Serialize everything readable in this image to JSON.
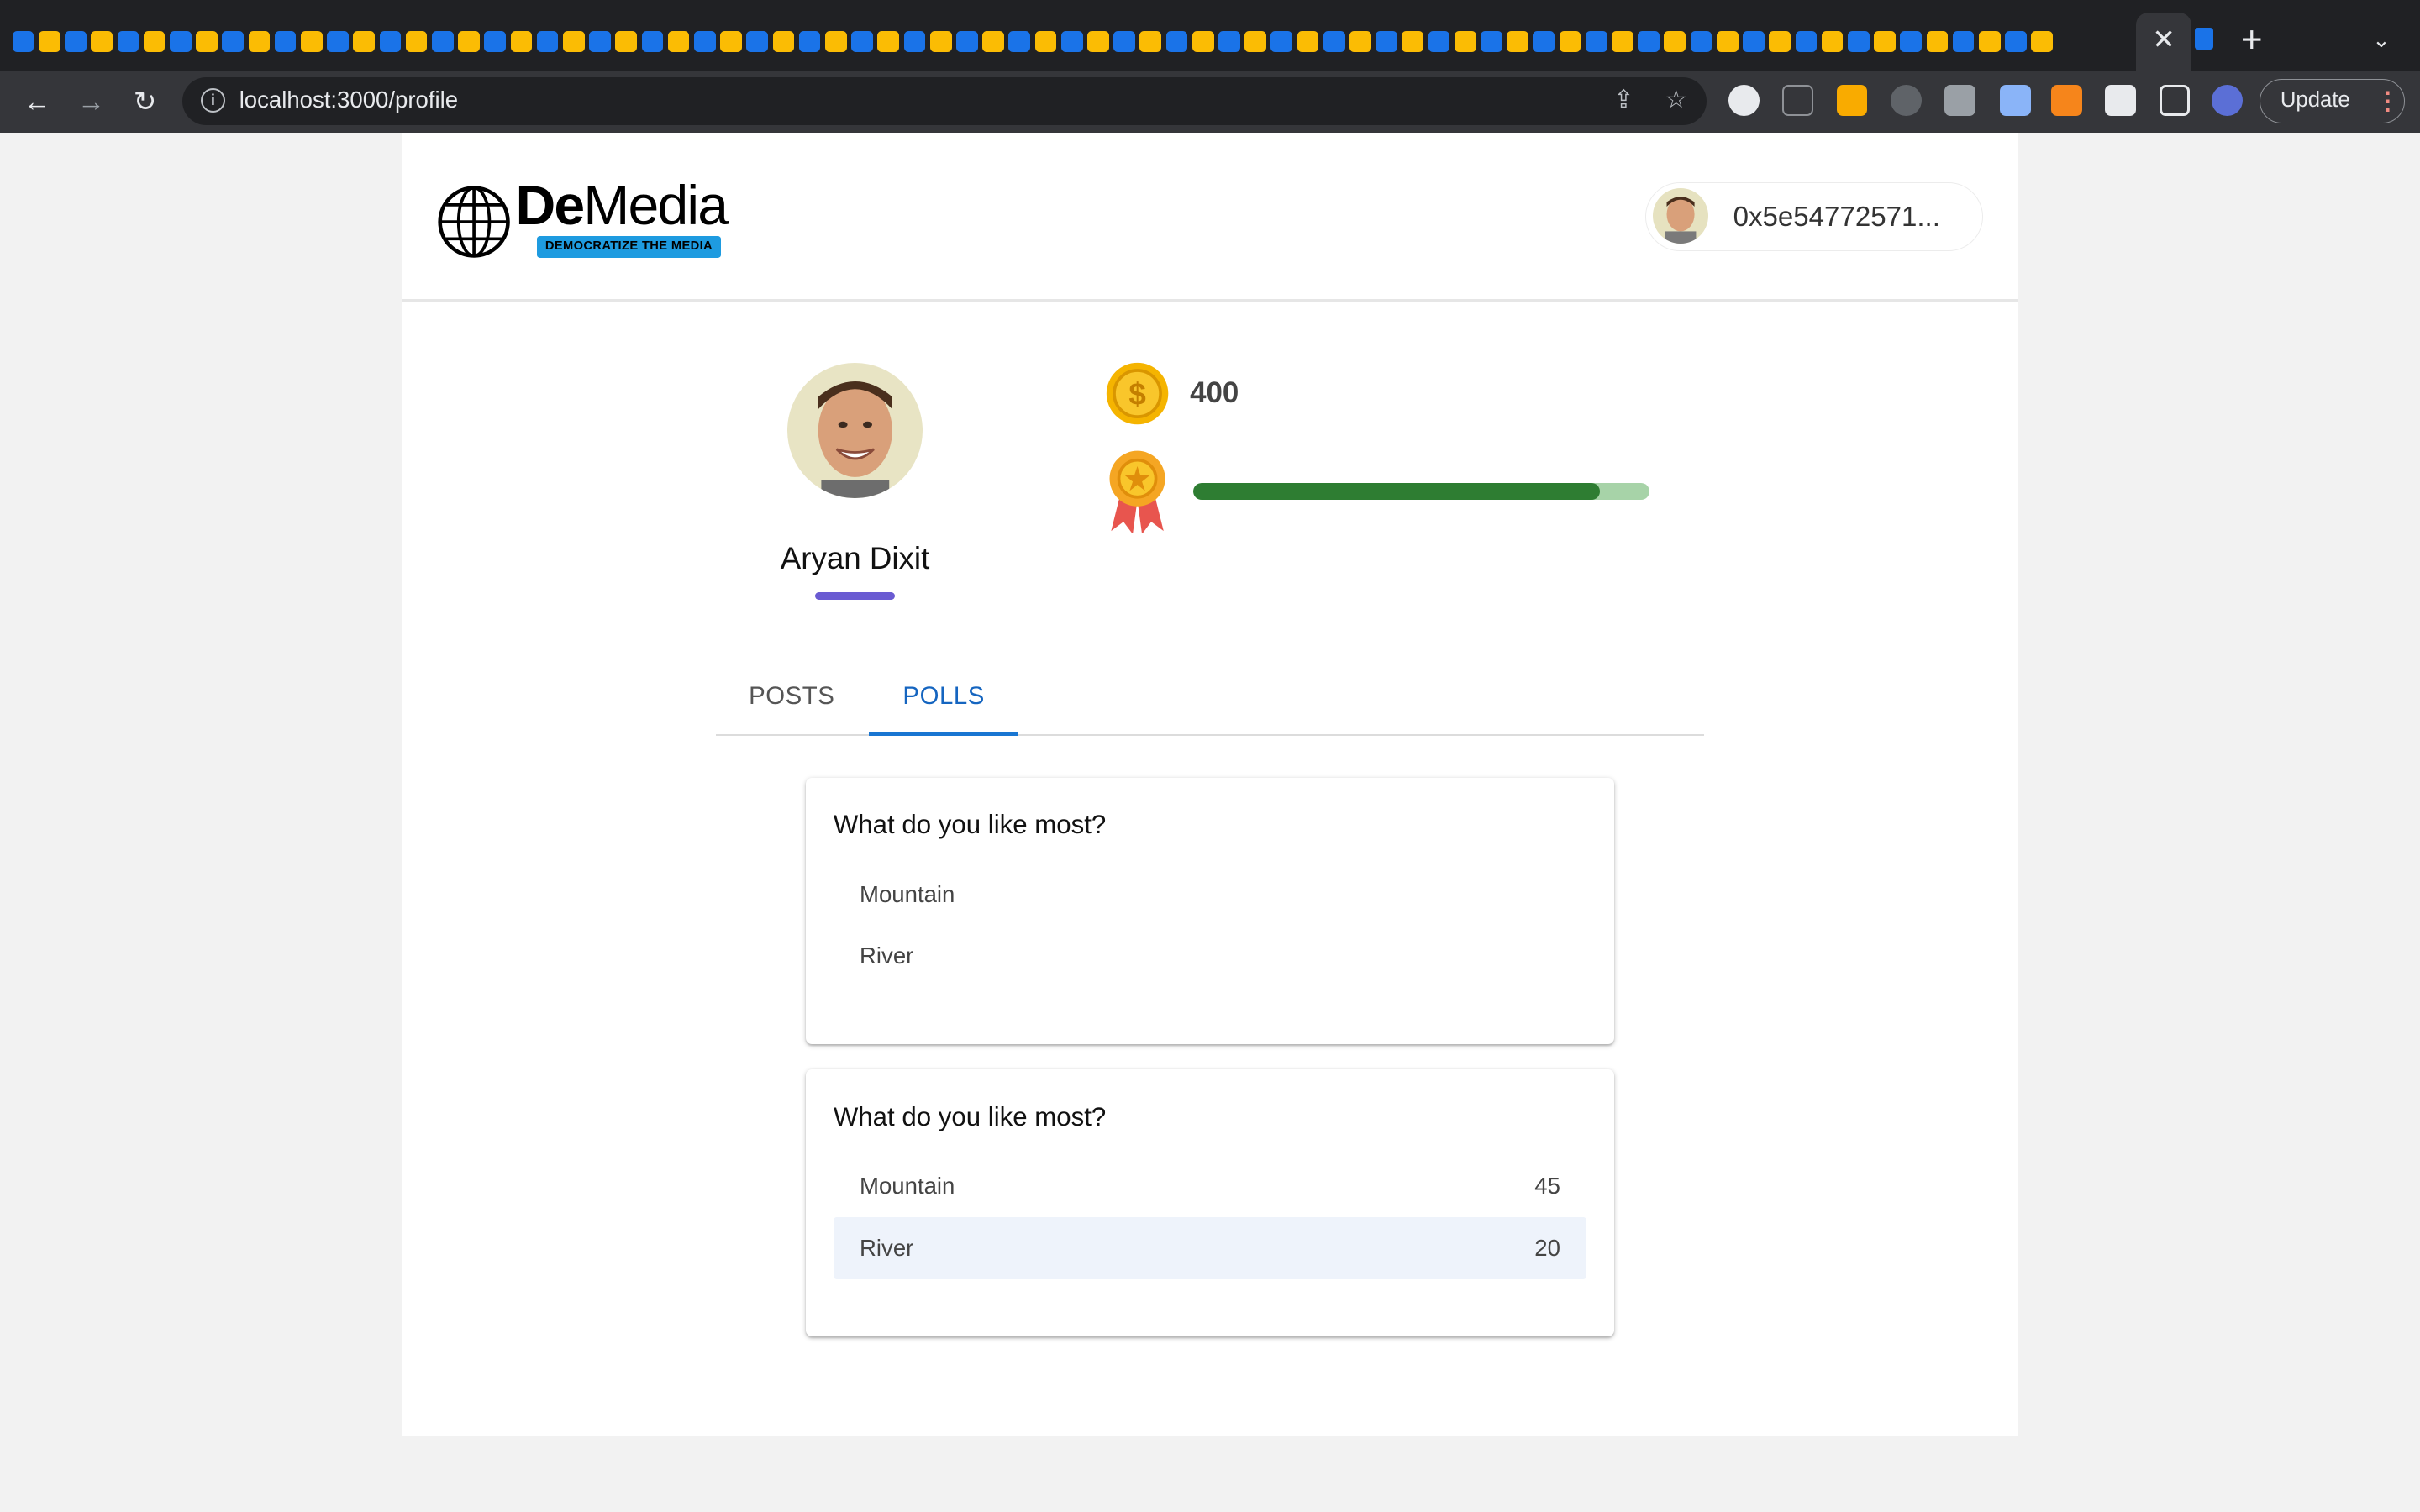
{
  "browser": {
    "url": "localhost:3000/profile",
    "update_label": "Update",
    "tab_close_glyph": "✕",
    "new_tab_glyph": "+"
  },
  "header": {
    "logo_prefix": "De",
    "logo_suffix": "Media",
    "logo_tagline": "DEMOCRATIZE THE MEDIA",
    "wallet_address": "0x5e54772571..."
  },
  "profile": {
    "name": "Aryan Dixit",
    "coins": "400",
    "reputation_progress": 0.89,
    "colors": {
      "progress_fill": "#2e7d32",
      "progress_track": "#a7d3a8",
      "underline": "#6a5bd2"
    }
  },
  "tabs": [
    {
      "label": "POSTS",
      "active": false
    },
    {
      "label": "POLLS",
      "active": true
    }
  ],
  "polls": [
    {
      "question": "What do you like most?",
      "options": [
        {
          "label": "Mountain",
          "count": ""
        },
        {
          "label": "River",
          "count": ""
        }
      ]
    },
    {
      "question": "What do you like most?",
      "options": [
        {
          "label": "Mountain",
          "count": "45"
        },
        {
          "label": "River",
          "count": "20",
          "selected": true
        }
      ]
    }
  ]
}
